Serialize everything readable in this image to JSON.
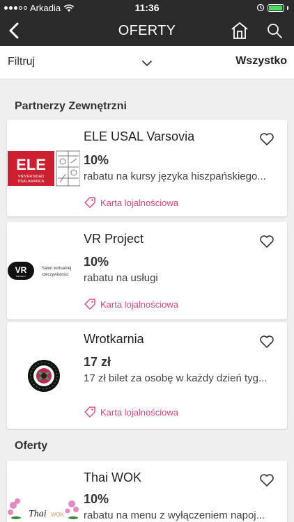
{
  "status_bar": {
    "carrier": "Arkadia",
    "time": "11:36"
  },
  "nav": {
    "title": "OFERTY"
  },
  "filter": {
    "label": "Filtruj",
    "value": "Wszystko"
  },
  "sections": [
    {
      "title": "Partnerzy Zewnętrzni",
      "offers": [
        {
          "name": "ELE USAL Varsovia",
          "amount": "10%",
          "description": "rabatu na kursy języka hiszpańskiego...",
          "tag": "Karta lojalnościowa",
          "logo": {
            "text": "ELE",
            "subtext_1": "VNIVERSIDAD",
            "subtext_2": "DSALAMANCA"
          }
        },
        {
          "name": "VR Project",
          "amount": "10%",
          "description": "rabatu na usługi",
          "tag": "Karta lojalnościowa",
          "logo": {
            "text": "VR",
            "subtext": "PROJECT",
            "side_1": "Salon wirtualnej",
            "side_2": "rzeczywistości"
          }
        },
        {
          "name": "Wrotkarnia",
          "amount": "17 zł",
          "description": "17 zł bilet za osobę w każdy dzień tyg...",
          "tag": "Karta lojalnościowa"
        }
      ]
    },
    {
      "title": "Oferty",
      "offers": [
        {
          "name": "Thai WOK",
          "amount": "10%",
          "description": "rabatu na menu z wyłączeniem napoj...",
          "logo": {
            "text": "Thai",
            "subtext": "WOK"
          }
        }
      ]
    }
  ],
  "colors": {
    "bar": "#2a2a2a",
    "accent": "#d9487d",
    "battery": "#4cd964",
    "ele_red": "#cc1f2f"
  }
}
